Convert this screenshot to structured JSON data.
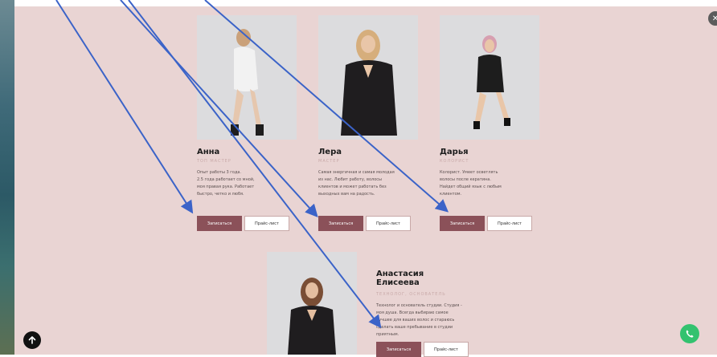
{
  "team": {
    "members": [
      {
        "name": "Анна",
        "role": "ТОП МАСТЕР",
        "description": [
          "Опыт работы 3 года.",
          "2.5 года работает со мной,",
          "моя правая рука. Работает",
          "быстро, четко и любя."
        ],
        "book_label": "Записаться",
        "price_label": "Прайс-лист"
      },
      {
        "name": "Лера",
        "role": "МАСТЕР",
        "description": [
          "Самая энергичная и самая молодая",
          "из нас. Любит работу, волосы",
          "клиентов и может работать без",
          "выходных вам на радость."
        ],
        "book_label": "Записаться",
        "price_label": "Прайс-лист"
      },
      {
        "name": "Дарья",
        "role": "КОЛОРИСТ",
        "description": [
          "Колорист. Умеет осветлять",
          "волосы после кератина.",
          "Найдет общий язык с любым",
          "клиентом."
        ],
        "book_label": "Записаться",
        "price_label": "Прайс-лист"
      },
      {
        "name_line1": "Анастасия",
        "name_line2": "Елисеева",
        "role": "ТЕХНОЛОГ, ОСНОВАТЕЛЬ",
        "description": [
          "Технолог и основатель студии. Студия -",
          "моя душа. Всегда выбираю самое",
          "лучшее для ваших волос и стараюсь",
          "сделать ваше пребывание в студии",
          "приятным."
        ],
        "book_label": "Записаться",
        "price_label": "Прайс-лист"
      }
    ]
  },
  "controls": {
    "close_glyph": "✕",
    "scroll_top_icon": "arrow-up-icon",
    "call_icon": "phone-icon"
  },
  "colors": {
    "panel_bg": "#e9d4d3",
    "primary_button": "#8b5159",
    "annotation_arrow": "#3b63c8",
    "call_button": "#33c26f"
  }
}
